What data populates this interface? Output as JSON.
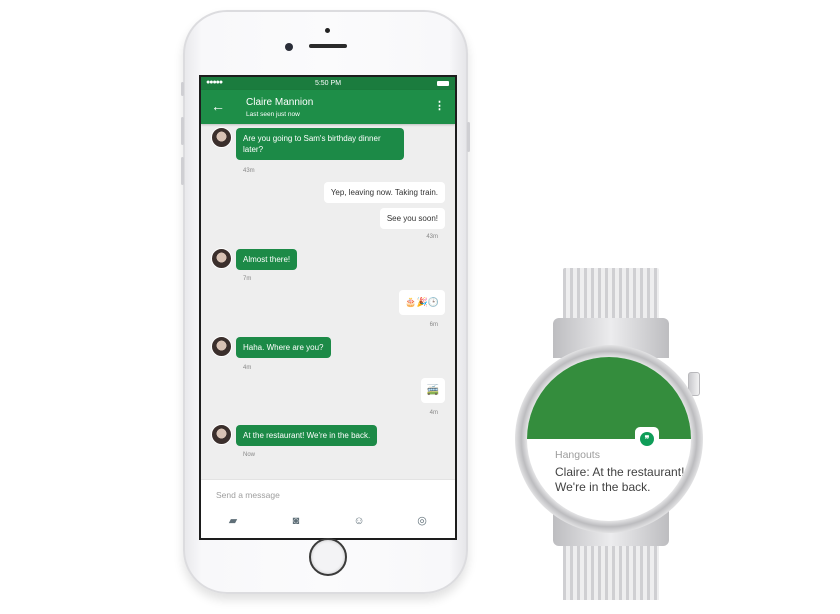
{
  "phone": {
    "statusbar": {
      "signal": "●●●●●",
      "time": "5:50 PM"
    },
    "appbar": {
      "back_icon": "←",
      "contact_name": "Claire Mannion",
      "contact_status": "Last seen just now",
      "more_icon": "⋮"
    },
    "messages": [
      {
        "direction": "in",
        "text": "Are you going to Sam's birthday dinner later?",
        "time": "43m"
      },
      {
        "direction": "out",
        "text": "Yep, leaving now. Taking train.",
        "time": ""
      },
      {
        "direction": "out",
        "text": "See you soon!",
        "time": "43m"
      },
      {
        "direction": "in",
        "text": "Almost there!",
        "time": "7m"
      },
      {
        "direction": "out",
        "text": "🎂🎉🕒",
        "time": "6m"
      },
      {
        "direction": "in",
        "text": "Haha. Where are you?",
        "time": "4m"
      },
      {
        "direction": "out",
        "text": "🚎",
        "time": "4m"
      },
      {
        "direction": "in",
        "text": "At the restaurant! We're in the back.",
        "time": "Now"
      }
    ],
    "composer": {
      "placeholder": "Send a message",
      "icons": {
        "image": "▰",
        "camera": "◙",
        "sticker": "☺",
        "location": "◎"
      }
    }
  },
  "watch": {
    "notification": {
      "app_name": "Hangouts",
      "app_icon": "❞",
      "message": "Claire: At the restaurant! We're in the back."
    }
  }
}
